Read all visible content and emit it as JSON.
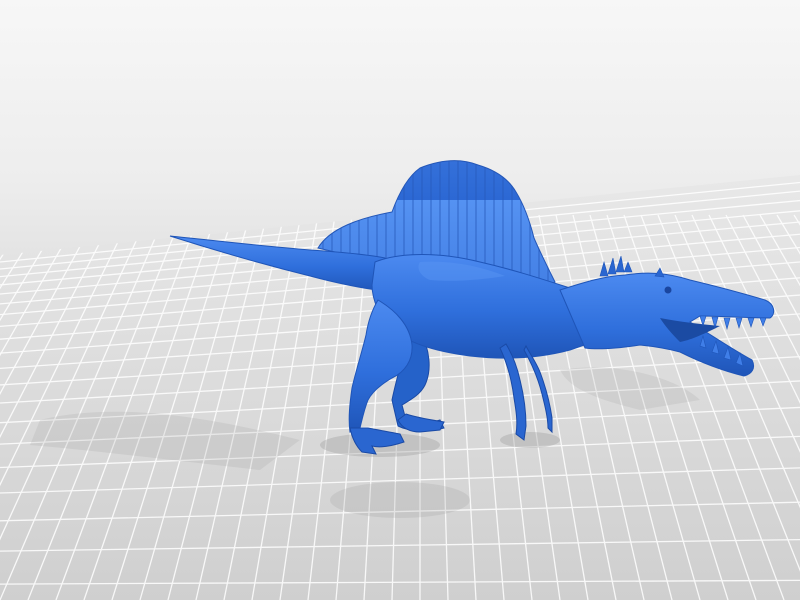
{
  "scene": {
    "background_color": "#eeeeee",
    "floor_color": "#d9d9d9",
    "grid_line_color": "#ffffff",
    "model_color": "#2f6fdc",
    "model_shade_color": "#1f55b8",
    "model_highlight_color": "#4c8af0",
    "shadow_color": "#bdbdbd"
  }
}
